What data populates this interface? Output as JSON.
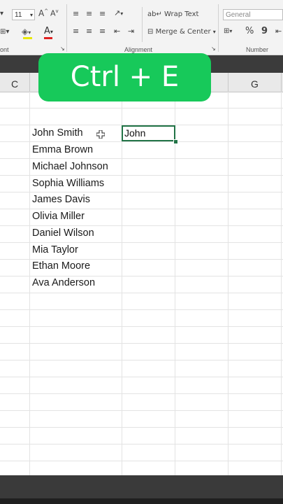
{
  "ribbon": {
    "font_size": "11",
    "wrap_text": "Wrap Text",
    "merge_center": "Merge & Center",
    "number_format": "General",
    "percent_symbol": "%",
    "comma_symbol": "9",
    "group_font": "ont",
    "group_alignment": "Alignment",
    "group_number": "Number"
  },
  "columns": {
    "c": "C",
    "g": "G"
  },
  "names": [
    "John Smith",
    "Emma Brown",
    "Michael Johnson",
    "Sophia Williams",
    "James Davis",
    "Olivia Miller",
    "Daniel Wilson",
    "Mia Taylor",
    "Ethan Moore",
    "Ava Anderson"
  ],
  "active_cell": {
    "value": "John"
  },
  "overlay": {
    "shortcut": "Ctrl + E",
    "color": "#17c95a"
  },
  "accent": "#217346"
}
